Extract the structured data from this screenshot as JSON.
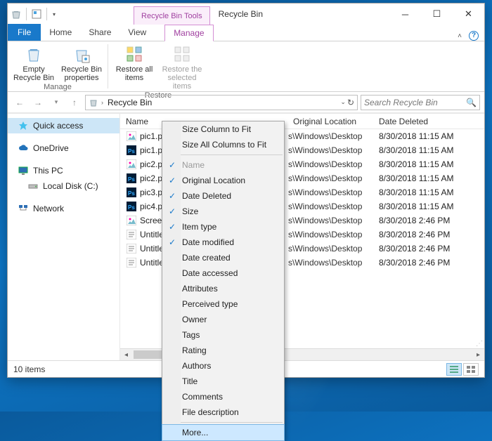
{
  "window": {
    "context_tab": "Recycle Bin Tools",
    "title": "Recycle Bin"
  },
  "tabs": {
    "file": "File",
    "home": "Home",
    "share": "Share",
    "view": "View",
    "manage": "Manage"
  },
  "ribbon": {
    "empty": "Empty Recycle Bin",
    "properties": "Recycle Bin properties",
    "restore_all": "Restore all items",
    "restore_selected": "Restore the selected items",
    "group_manage": "Manage",
    "group_restore": "Restore"
  },
  "nav": {
    "location": "Recycle Bin",
    "search_placeholder": "Search Recycle Bin"
  },
  "columns": {
    "name": "Name",
    "original_location": "Original Location",
    "date_deleted": "Date Deleted"
  },
  "sidebar": {
    "items": [
      {
        "label": "Quick access",
        "icon": "star",
        "selected": true
      },
      {
        "label": "OneDrive",
        "icon": "cloud"
      },
      {
        "label": "This PC",
        "icon": "pc"
      },
      {
        "label": "Local Disk (C:)",
        "icon": "drive"
      },
      {
        "label": "Network",
        "icon": "network"
      }
    ]
  },
  "files": [
    {
      "name": "pic1.pn",
      "icon": "img",
      "location": "s\\Windows\\Desktop",
      "date": "8/30/2018 11:15 AM"
    },
    {
      "name": "pic1.ps",
      "icon": "psd",
      "location": "s\\Windows\\Desktop",
      "date": "8/30/2018 11:15 AM"
    },
    {
      "name": "pic2.pn",
      "icon": "img",
      "location": "s\\Windows\\Desktop",
      "date": "8/30/2018 11:15 AM"
    },
    {
      "name": "pic2.ps",
      "icon": "psd",
      "location": "s\\Windows\\Desktop",
      "date": "8/30/2018 11:15 AM"
    },
    {
      "name": "pic3.ps",
      "icon": "psd",
      "location": "s\\Windows\\Desktop",
      "date": "8/30/2018 11:15 AM"
    },
    {
      "name": "pic4.ps",
      "icon": "psd",
      "location": "s\\Windows\\Desktop",
      "date": "8/30/2018 11:15 AM"
    },
    {
      "name": "Screens",
      "icon": "img",
      "location": "s\\Windows\\Desktop",
      "date": "8/30/2018 2:46 PM"
    },
    {
      "name": "Untitle",
      "icon": "txt",
      "location": "s\\Windows\\Desktop",
      "date": "8/30/2018 2:46 PM"
    },
    {
      "name": "Untitle",
      "icon": "txt",
      "location": "s\\Windows\\Desktop",
      "date": "8/30/2018 2:46 PM"
    },
    {
      "name": "Untitle",
      "icon": "txt",
      "location": "s\\Windows\\Desktop",
      "date": "8/30/2018 2:46 PM"
    }
  ],
  "status": {
    "count": "10 items"
  },
  "menu": {
    "size_fit": "Size Column to Fit",
    "size_all": "Size All Columns to Fit",
    "columns": [
      {
        "label": "Name",
        "checked": true,
        "disabled": true
      },
      {
        "label": "Original Location",
        "checked": true
      },
      {
        "label": "Date Deleted",
        "checked": true
      },
      {
        "label": "Size",
        "checked": true
      },
      {
        "label": "Item type",
        "checked": true
      },
      {
        "label": "Date modified",
        "checked": true
      },
      {
        "label": "Date created"
      },
      {
        "label": "Date accessed"
      },
      {
        "label": "Attributes"
      },
      {
        "label": "Perceived type"
      },
      {
        "label": "Owner"
      },
      {
        "label": "Tags"
      },
      {
        "label": "Rating"
      },
      {
        "label": "Authors"
      },
      {
        "label": "Title"
      },
      {
        "label": "Comments"
      },
      {
        "label": "File description"
      }
    ],
    "more": "More..."
  }
}
